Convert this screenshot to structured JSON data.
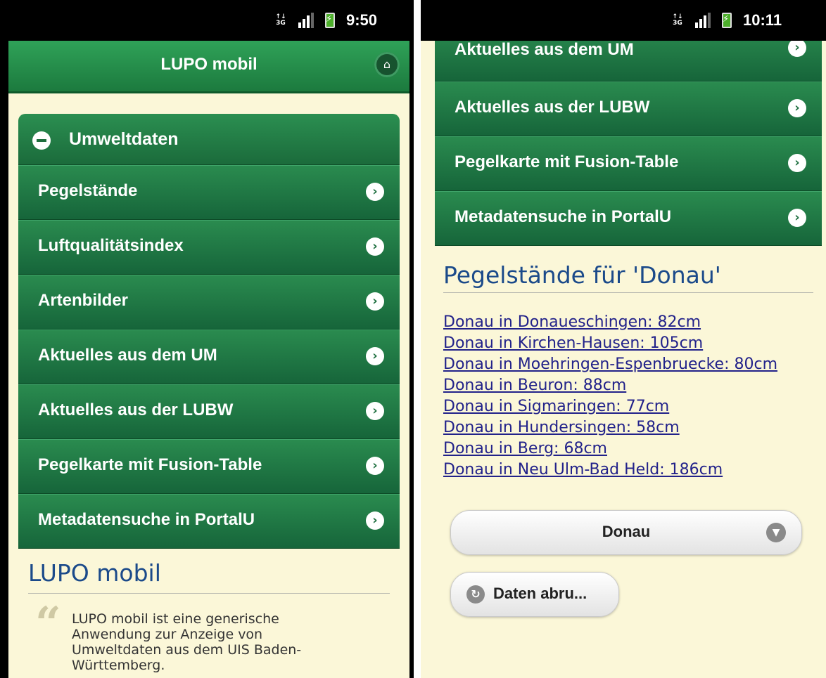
{
  "left": {
    "status": {
      "time": "9:50",
      "network": "3G"
    },
    "header": {
      "title": "LUPO mobil",
      "home_icon": "home-icon"
    },
    "menu": {
      "title": "Umweltdaten",
      "items": [
        {
          "label": "Pegelstände"
        },
        {
          "label": "Luftqualitätsindex"
        },
        {
          "label": "Artenbilder"
        },
        {
          "label": "Aktuelles aus dem UM"
        },
        {
          "label": "Aktuelles aus der LUBW"
        },
        {
          "label": "Pegelkarte mit Fusion-Table"
        },
        {
          "label": "Metadatensuche in PortalU"
        }
      ]
    },
    "about": {
      "title": "LUPO mobil",
      "lines": [
        "LUPO mobil ist eine generische",
        "Anwendung zur Anzeige von",
        "Umweltdaten aus dem UIS Baden-",
        "Württemberg."
      ]
    }
  },
  "right": {
    "status": {
      "time": "10:11",
      "network": "3G"
    },
    "menu": {
      "items": [
        {
          "label": "Aktuelles aus dem UM"
        },
        {
          "label": "Aktuelles aus der LUBW"
        },
        {
          "label": "Pegelkarte mit Fusion-Table"
        },
        {
          "label": "Metadatensuche in PortalU"
        }
      ]
    },
    "results": {
      "title": "Pegelstände für 'Donau'",
      "links": [
        "Donau in Donaueschingen: 82cm",
        "Donau in Kirchen-Hausen: 105cm",
        "Donau in Moehringen-Espenbruecke: 80cm",
        "Donau in Beuron: 88cm",
        "Donau in Sigmaringen: 77cm",
        "Donau in Hundersingen: 58cm",
        "Donau in Berg: 68cm",
        "Donau in Neu Ulm-Bad Held: 186cm"
      ]
    },
    "river_select": {
      "value": "Donau"
    },
    "fetch_button": {
      "label": "Daten abru..."
    }
  },
  "colors": {
    "accent_green": "#1f7a40",
    "background": "#fbf7d8",
    "link": "#22228a",
    "title_blue": "#1b4a8a"
  }
}
